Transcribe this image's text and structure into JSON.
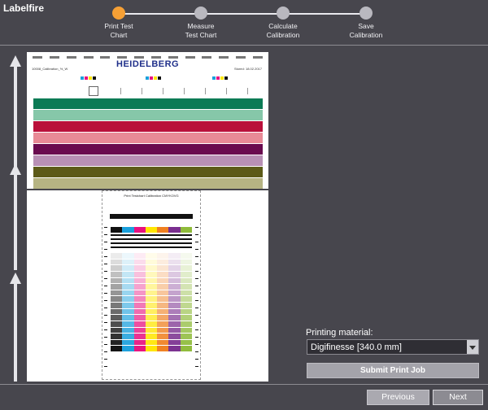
{
  "app": {
    "title": "Labelfire"
  },
  "steps": [
    {
      "label": "Print Test\nChart",
      "state": "active"
    },
    {
      "label": "Measure\nTest Chart",
      "state": "inactive"
    },
    {
      "label": "Calculate\nCalibration",
      "state": "inactive"
    },
    {
      "label": "Save\nCalibration",
      "state": "inactive"
    }
  ],
  "preview": {
    "brand": "HEIDELBERG",
    "file_name": "10008_Calibration_%_W",
    "stored": "Stored: 18.02.2017",
    "chart_title": "Print Testchart Calibration CMYKOVG",
    "band_colors": [
      "#0b7b55",
      "#86c7a9",
      "#b9103a",
      "#e88a96",
      "#6a0b4f",
      "#b890b5",
      "#5c5a18",
      "#b6b483"
    ],
    "swatch_colors": [
      "#111111",
      "#1aa0dc",
      "#e8117f",
      "#ffe600",
      "#f08020",
      "#7a2f8f",
      "#8fbb3a"
    ]
  },
  "printing_material": {
    "label": "Printing material:",
    "value": "Digifinesse [340.0 mm]"
  },
  "buttons": {
    "submit": "Submit Print Job",
    "previous": "Previous",
    "next": "Next"
  }
}
